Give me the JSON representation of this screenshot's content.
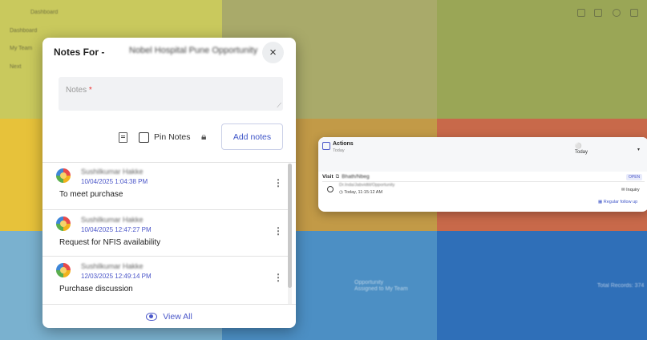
{
  "notes_panel": {
    "title": "Notes For -",
    "subtitle": "Nobel Hospital Pune Opportunity",
    "close_glyph": "×",
    "notes_label": "Notes",
    "required_mark": "*",
    "pin_notes_label": "Pin Notes",
    "add_notes_label": "Add notes",
    "view_all_label": "View All",
    "notes": [
      {
        "author": "Sushilkumar Hakke",
        "timestamp": "10/04/2025 1:04:38 PM",
        "text": "To meet purchase"
      },
      {
        "author": "Sushilkumar Hakke",
        "timestamp": "10/04/2025 12:47:27 PM",
        "text": "Request for NFIS availability"
      },
      {
        "author": "Sushilkumar Hakke",
        "timestamp": "12/03/2025 12:49:14 PM",
        "text": "Purchase discussion"
      }
    ]
  },
  "actions_card": {
    "title": "Actions",
    "subtitle": "Today",
    "filter_value": "Today",
    "visit_label": "Visit",
    "visit_name": "Bhath/Nbeg",
    "status": "OPEN",
    "opportunity": "Dr.Inda/Jabvidtit/Opportunity",
    "time": "Today, 11:15:12 AM",
    "tag": "Inquiry",
    "follow_up": "Regular follow up"
  },
  "background": {
    "dashboard_label": "Dashboard",
    "section_label": "Dashboard",
    "my_team": "My Team",
    "next_label": "Next",
    "total_records": "Total Records: 374",
    "opportunity_label": "Opportunity",
    "assigned": "Assigned to My Team"
  },
  "colors": {
    "accent": "#3f56c8",
    "tile_yellow": "#e7c23a",
    "tile_olive": "#a9aa6a",
    "tile_orange": "#c8694a",
    "tile_blue": "#2f6fb8"
  }
}
